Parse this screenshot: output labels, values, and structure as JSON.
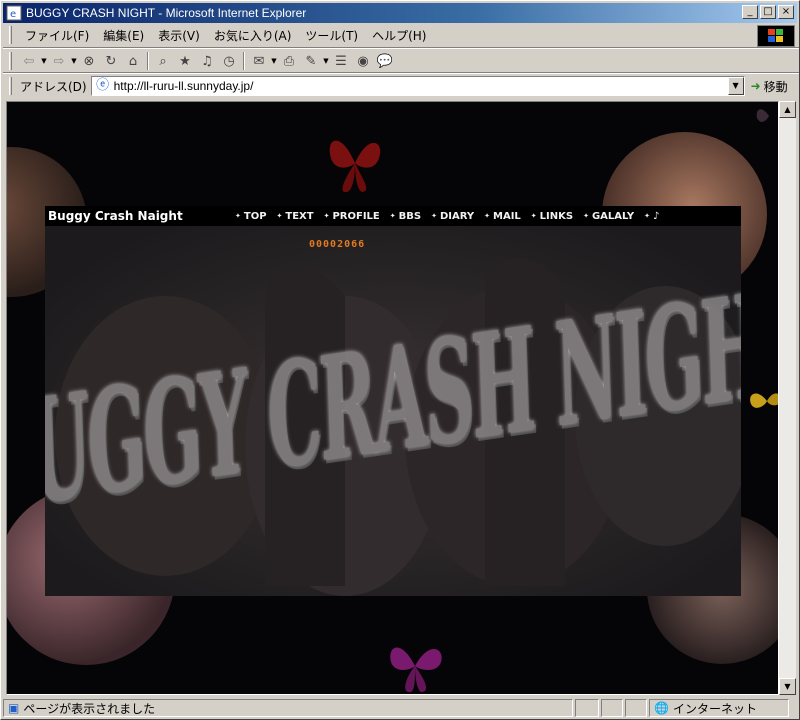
{
  "window": {
    "title": "BUGGY CRASH NIGHT - Microsoft Internet Explorer",
    "min_label": "_",
    "max_label": "□",
    "close_label": "×"
  },
  "menu": [
    "ファイル(F)",
    "編集(E)",
    "表示(V)",
    "お気に入り(A)",
    "ツール(T)",
    "ヘルプ(H)"
  ],
  "toolbar": {
    "back": "⇦",
    "forward": "⇨",
    "stop": "⊗",
    "refresh": "↻",
    "home": "⌂",
    "search": "⌕",
    "favorites": "★",
    "media": "♫",
    "history": "◷",
    "mail": "✉",
    "print": "⎙",
    "edit": "✎",
    "discuss": "☰",
    "messenger": "◉",
    "balloon": "💬"
  },
  "address": {
    "label": "アドレス(D)",
    "url": "http://ll-ruru-ll.sunnyday.jp/",
    "go_label": "移動"
  },
  "page": {
    "brand": "Buggy Crash Naight",
    "nav": [
      "TOP",
      "TEXT",
      "PROFILE",
      "BBS",
      "DIARY",
      "MAIL",
      "LINKS",
      "GALALY",
      "♪"
    ],
    "counter": "00002066",
    "banner_text": "BUGGY CRASH NIGHT"
  },
  "status": {
    "text": "ページが表示されました",
    "zone": "インターネット"
  },
  "colors": {
    "titlebar_start": "#0a246a",
    "counter": "#e07a20",
    "butterfly_red": "#7a1010",
    "butterfly_purple": "#7a1a6e",
    "butterfly_yellow": "#c9a01a"
  }
}
